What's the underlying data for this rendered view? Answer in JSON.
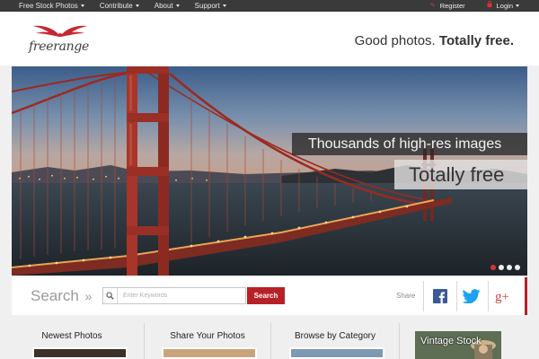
{
  "topnav": {
    "items": [
      {
        "label": "Free Stock Photos"
      },
      {
        "label": "Contribute"
      },
      {
        "label": "About"
      },
      {
        "label": "Support"
      }
    ],
    "register_label": "Register",
    "login_label": "Login"
  },
  "header": {
    "logo_text": "freerange",
    "tagline_plain": "Good photos.",
    "tagline_bold": "Totally free."
  },
  "hero": {
    "caption_primary": "Thousands of high-res images",
    "caption_secondary": "Totally free",
    "slide_count": 4,
    "active_slide": 1
  },
  "search": {
    "label": "Search",
    "chevrons": "»",
    "placeholder": "Enter Keywords",
    "button_label": "Search",
    "share_label": "Share",
    "social": [
      "facebook-icon",
      "twitter-icon",
      "google-plus-icon"
    ]
  },
  "columns": [
    {
      "title": "Newest Photos"
    },
    {
      "title": "Share Your Photos"
    },
    {
      "title": "Browse by Category"
    }
  ],
  "promo": {
    "text": "Vintage Stock"
  },
  "colors": {
    "accent": "#b72027",
    "topbar": "#3a3a3a",
    "facebook": "#3b5998",
    "twitter": "#1da1f2",
    "google_plus": "#c5453d"
  }
}
